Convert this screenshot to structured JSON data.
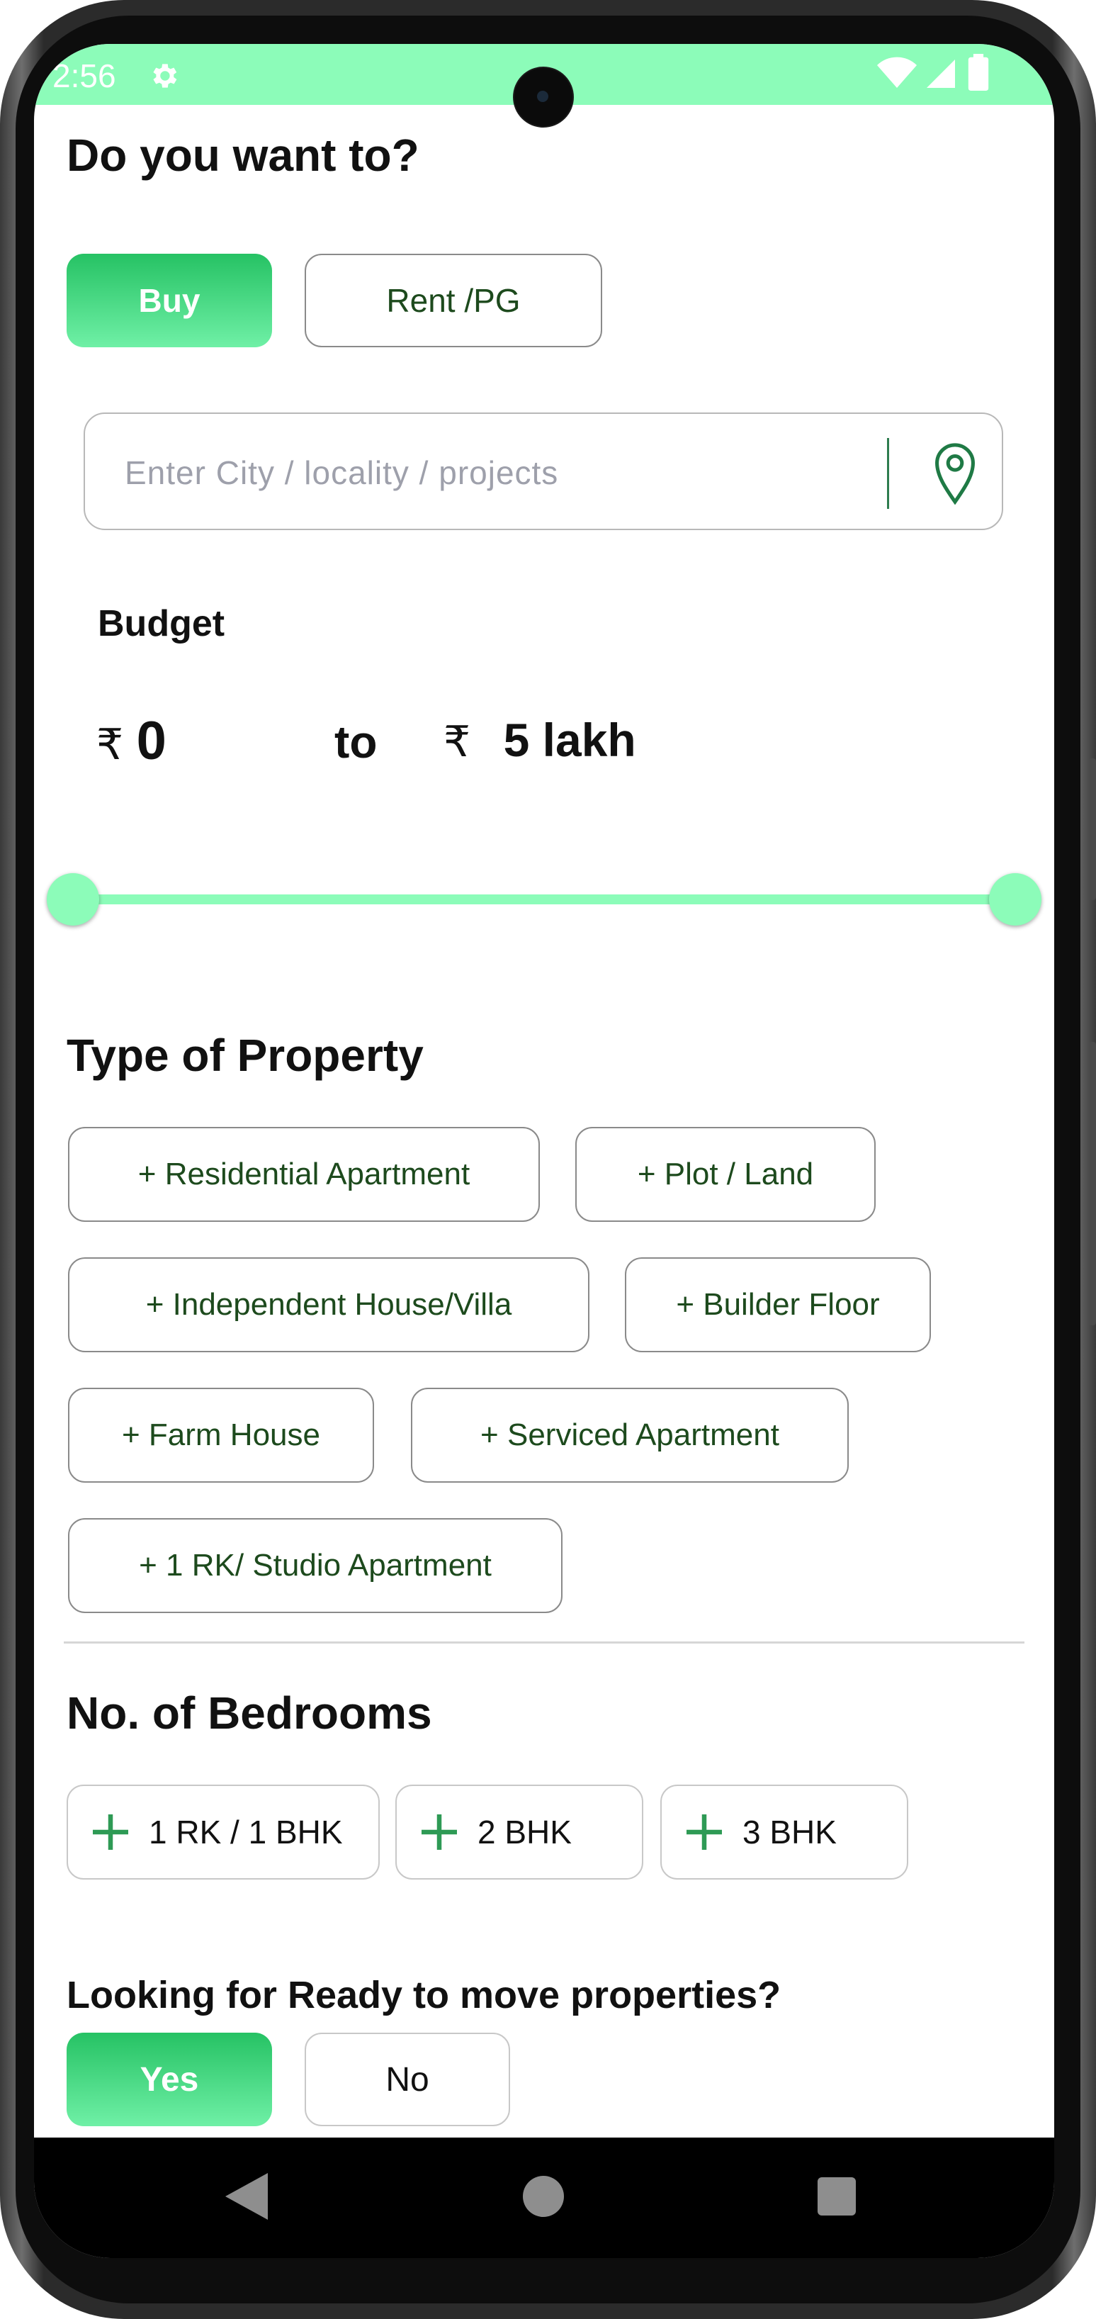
{
  "status_bar": {
    "time": "2:56",
    "background": "#8cfcb9"
  },
  "intent": {
    "title": "Do you want to?",
    "options": [
      "Buy",
      "Rent /PG"
    ],
    "selected": "Buy"
  },
  "search": {
    "placeholder": "Enter City / locality / projects",
    "icon": "map-pin-icon"
  },
  "budget": {
    "label": "Budget",
    "currency_symbol": "₹",
    "min": "0",
    "separator": "to",
    "max": "5 lakh",
    "slider": {
      "min_fraction": 0.0,
      "max_fraction": 1.0
    }
  },
  "property_type": {
    "title": "Type of Property",
    "options": [
      "+ Residential Apartment",
      "+ Plot / Land",
      "+ Independent House/Villa",
      "+ Builder Floor",
      "+ Farm House",
      "+ Serviced Apartment",
      "+ 1 RK/ Studio Apartment"
    ]
  },
  "bedrooms": {
    "title": "No. of Bedrooms",
    "options": [
      "1 RK / 1 BHK",
      "2 BHK",
      "3 BHK"
    ]
  },
  "ready_to_move": {
    "question": "Looking for Ready to move properties?",
    "options": [
      "Yes",
      "No"
    ],
    "selected": "Yes"
  },
  "colors": {
    "accent": "#8cfcb9",
    "button_gradient_top": "#26c264",
    "button_gradient_bottom": "#6ff0a6",
    "pill_text": "#1d4a1d"
  },
  "icons": [
    "settings-gear-icon",
    "wifi-icon",
    "signal-icon",
    "battery-icon",
    "map-pin-icon",
    "plus-icon",
    "back-triangle-icon",
    "home-circle-icon",
    "recents-square-icon"
  ]
}
